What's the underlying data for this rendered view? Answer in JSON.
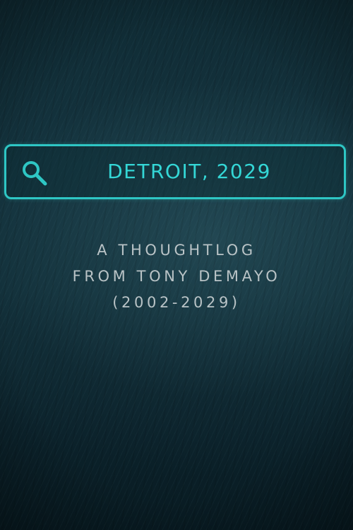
{
  "search": {
    "query": "DETROIT, 2029",
    "icon": "search-icon",
    "accent_color": "#2ec6c4"
  },
  "caption": {
    "line1": "A THOUGHTLOG",
    "line2": "FROM TONY DEMAYO",
    "line3": "(2002-2029)"
  }
}
